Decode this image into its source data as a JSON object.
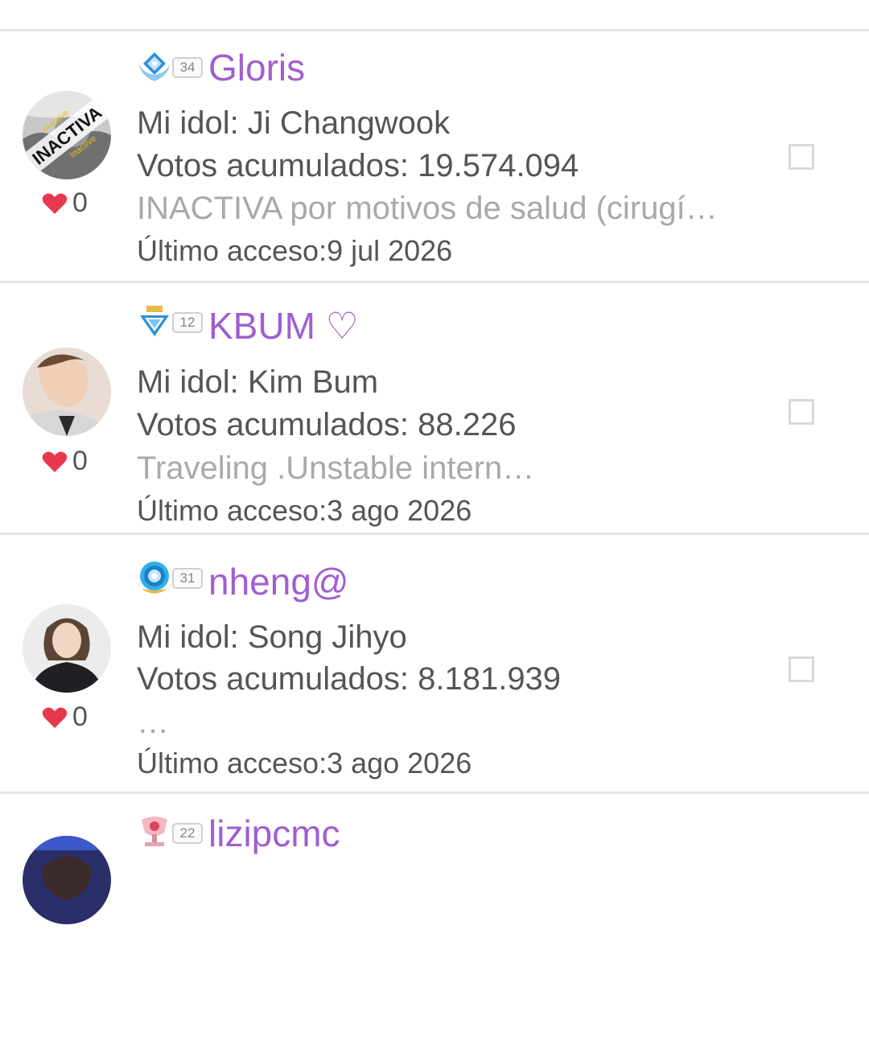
{
  "members": [
    {
      "badge_level": "34",
      "username": "Gloris",
      "idol": "Mi idol: Ji Changwook",
      "votes": "Votos acumulados: 19.574.094",
      "status": "INACTIVA por motivos de salud (cirugí…",
      "last_access": "Último acceso:9 jul 2026",
      "likes": "0",
      "avatar_text": "INACTIVA",
      "avatar_small_text": "Inactive"
    },
    {
      "badge_level": "12",
      "username": "KBUM ♡",
      "idol": "Mi idol: Kim Bum",
      "votes": "Votos acumulados: 88.226",
      "status": "Traveling .Unstable intern…",
      "last_access": "Último acceso:3 ago 2026",
      "likes": "0"
    },
    {
      "badge_level": "31",
      "username": "nheng@",
      "idol": "Mi idol: Song Jihyo",
      "votes": "Votos acumulados: 8.181.939",
      "status": "…",
      "last_access": "Último acceso:3 ago 2026",
      "likes": "0"
    },
    {
      "badge_level": "22",
      "username": "lizipcmc"
    }
  ],
  "colors": {
    "username": "#a05fd0",
    "heart": "#e8384f",
    "text": "#555555",
    "status": "#a9a9a9"
  },
  "icons": {
    "like": "heart-icon",
    "badge": "rank-badge-icon",
    "select": "checkbox"
  }
}
